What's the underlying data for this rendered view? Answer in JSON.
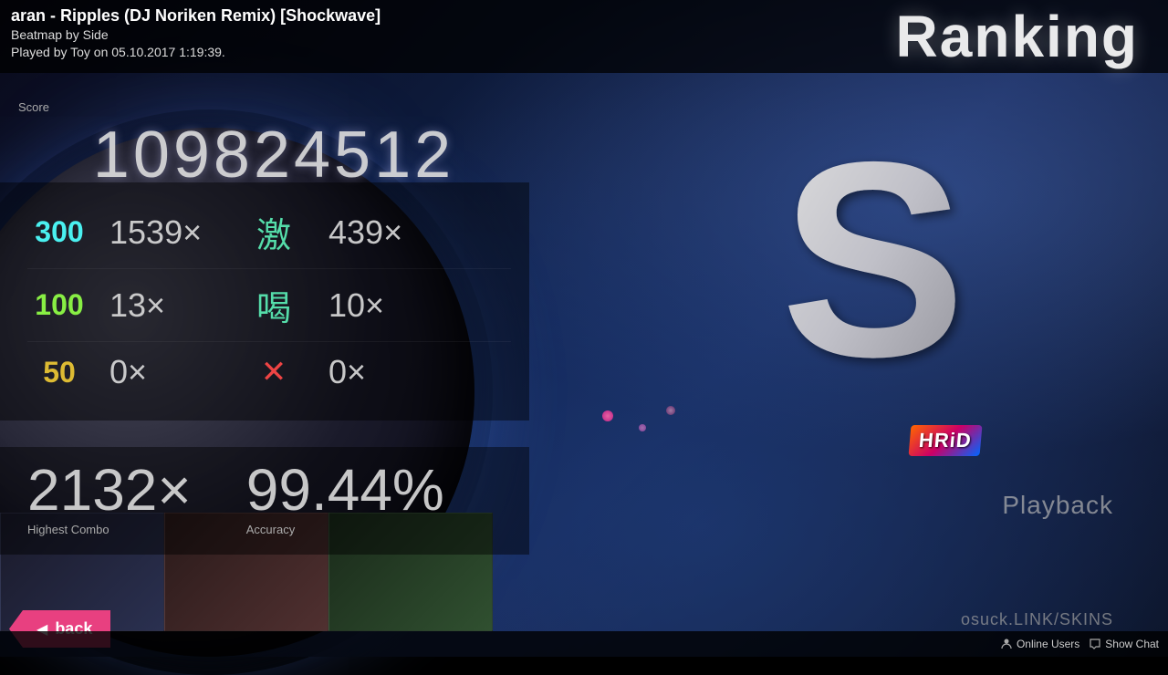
{
  "header": {
    "song_title": "aran - Ripples (DJ Noriken Remix) [Shockwave]",
    "beatmap_by": "Beatmap by Side",
    "played_by": "Played by Toy on 05.10.2017 1:19:39.",
    "ranking_label": "Ranking"
  },
  "score": {
    "value": "109824512",
    "label": "Score"
  },
  "hits": {
    "h300": {
      "label": "300",
      "count": "1539×",
      "kanji": "激",
      "kanji_count": "439×"
    },
    "h100": {
      "label": "100",
      "count": "13×",
      "kanji": "喝",
      "kanji_count": "10×"
    },
    "h50": {
      "label": "50",
      "count": "0×",
      "kanji": "✕",
      "kanji_count": "0×"
    }
  },
  "bottom_stats": {
    "combo": {
      "value": "2132×",
      "label": "Highest Combo"
    },
    "accuracy": {
      "value": "99.44%",
      "label": "Accuracy"
    }
  },
  "rank": "S",
  "hrid_badge": "HRiD",
  "playback_label": "Playback",
  "back_label": "back",
  "osuck_link": "osuck.LINK/SKINS",
  "bottom_bar": {
    "online_users": "Online Users",
    "show_chat": "Show Chat"
  }
}
